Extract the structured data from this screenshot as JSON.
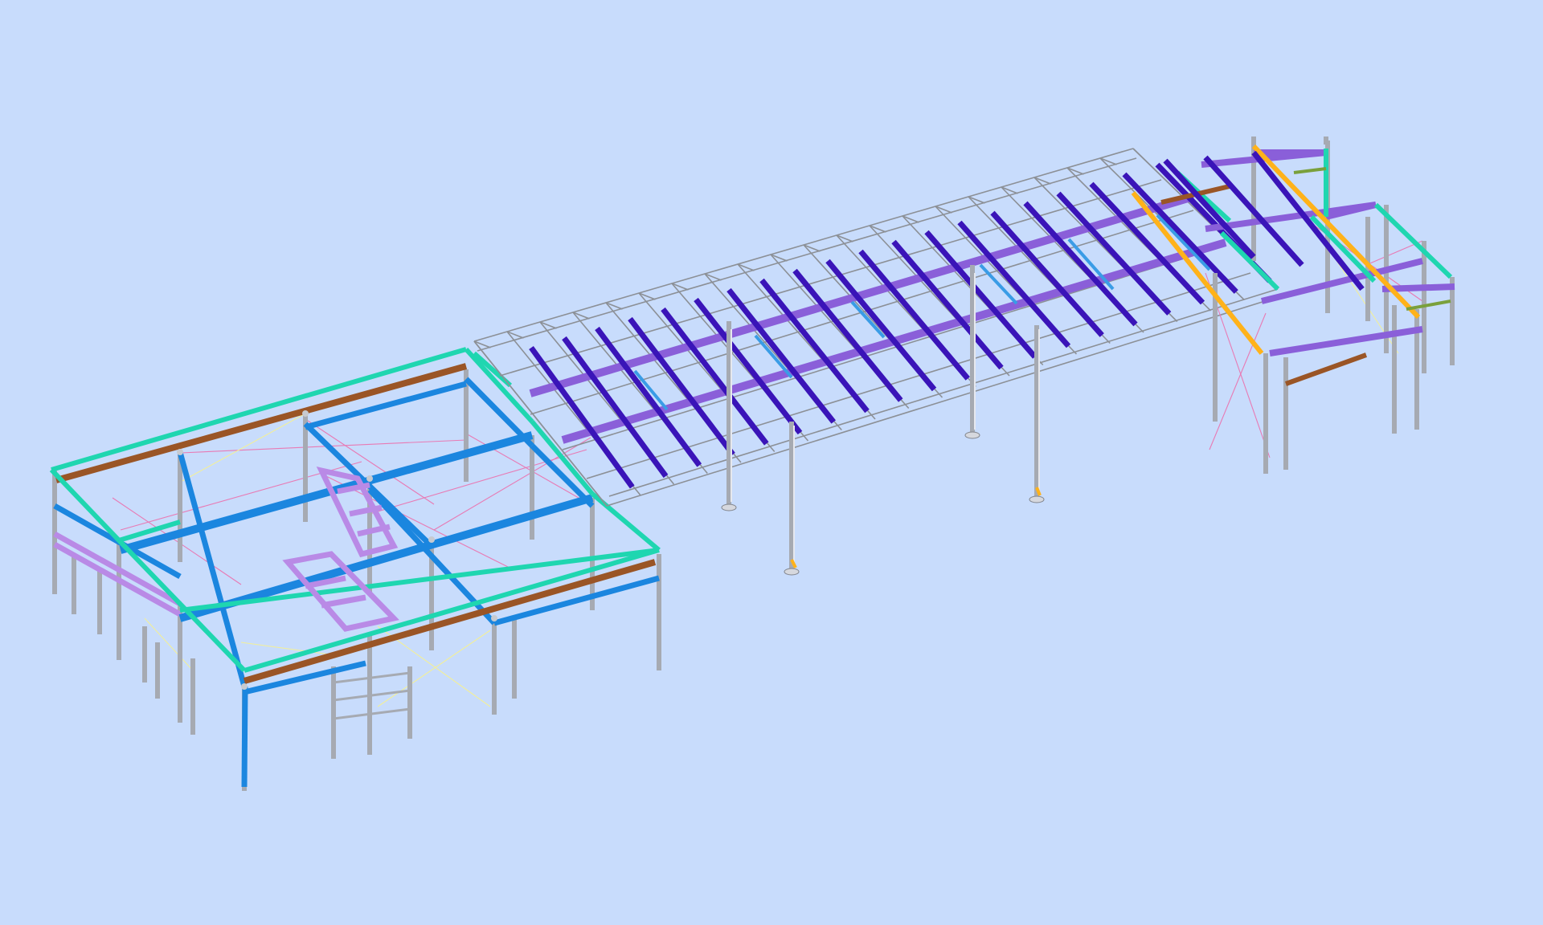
{
  "colors": {
    "background": "#c8dcfc",
    "column_steel": "#a6aab2",
    "truss_grey": "#8c9096",
    "beam_teal": "#1fd6b0",
    "beam_brown": "#9a5526",
    "beam_blue": "#1b86df",
    "beam_violet": "#b98ae6",
    "purlin_indigo": "#3a14b8",
    "beam_purple": "#8a5fd9",
    "member_orange": "#ffb21a",
    "member_olive": "#7aa03c",
    "bracing_pink": "#e87ab4",
    "bracing_yellow": "#f2ef9a"
  }
}
